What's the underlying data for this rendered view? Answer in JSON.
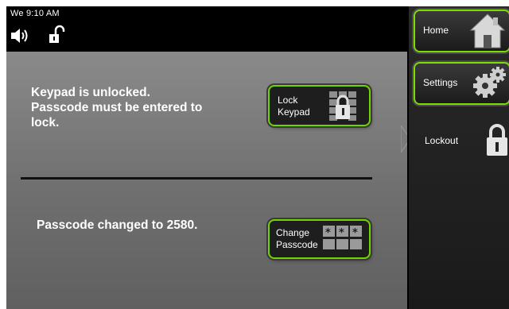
{
  "status_bar": {
    "clock": "We 9:10 AM",
    "speaker_icon": "speaker-volume-icon",
    "lock_icon": "unlocked-padlock-icon"
  },
  "main": {
    "unlocked_message": "Keypad is unlocked.\nPasscode must be entered to\nlock.",
    "lock_button_label": "Lock\nKeypad",
    "lock_button_icon": "keypad-lock-icon",
    "passcode_message": "Passcode changed to 2580.",
    "change_button_label": "Change\nPasscode",
    "change_button_icon": "passcode-dots-icon"
  },
  "sidebar": {
    "items": [
      {
        "label": "Home",
        "icon": "home-icon"
      },
      {
        "label": "Settings",
        "icon": "gear-icon"
      },
      {
        "label": "Lockout",
        "icon": "padlock-icon",
        "selected": true
      }
    ]
  },
  "colors": {
    "accent_green": "#7ddc00",
    "panel_gray": "#7a7a7a",
    "background_black": "#000000"
  }
}
